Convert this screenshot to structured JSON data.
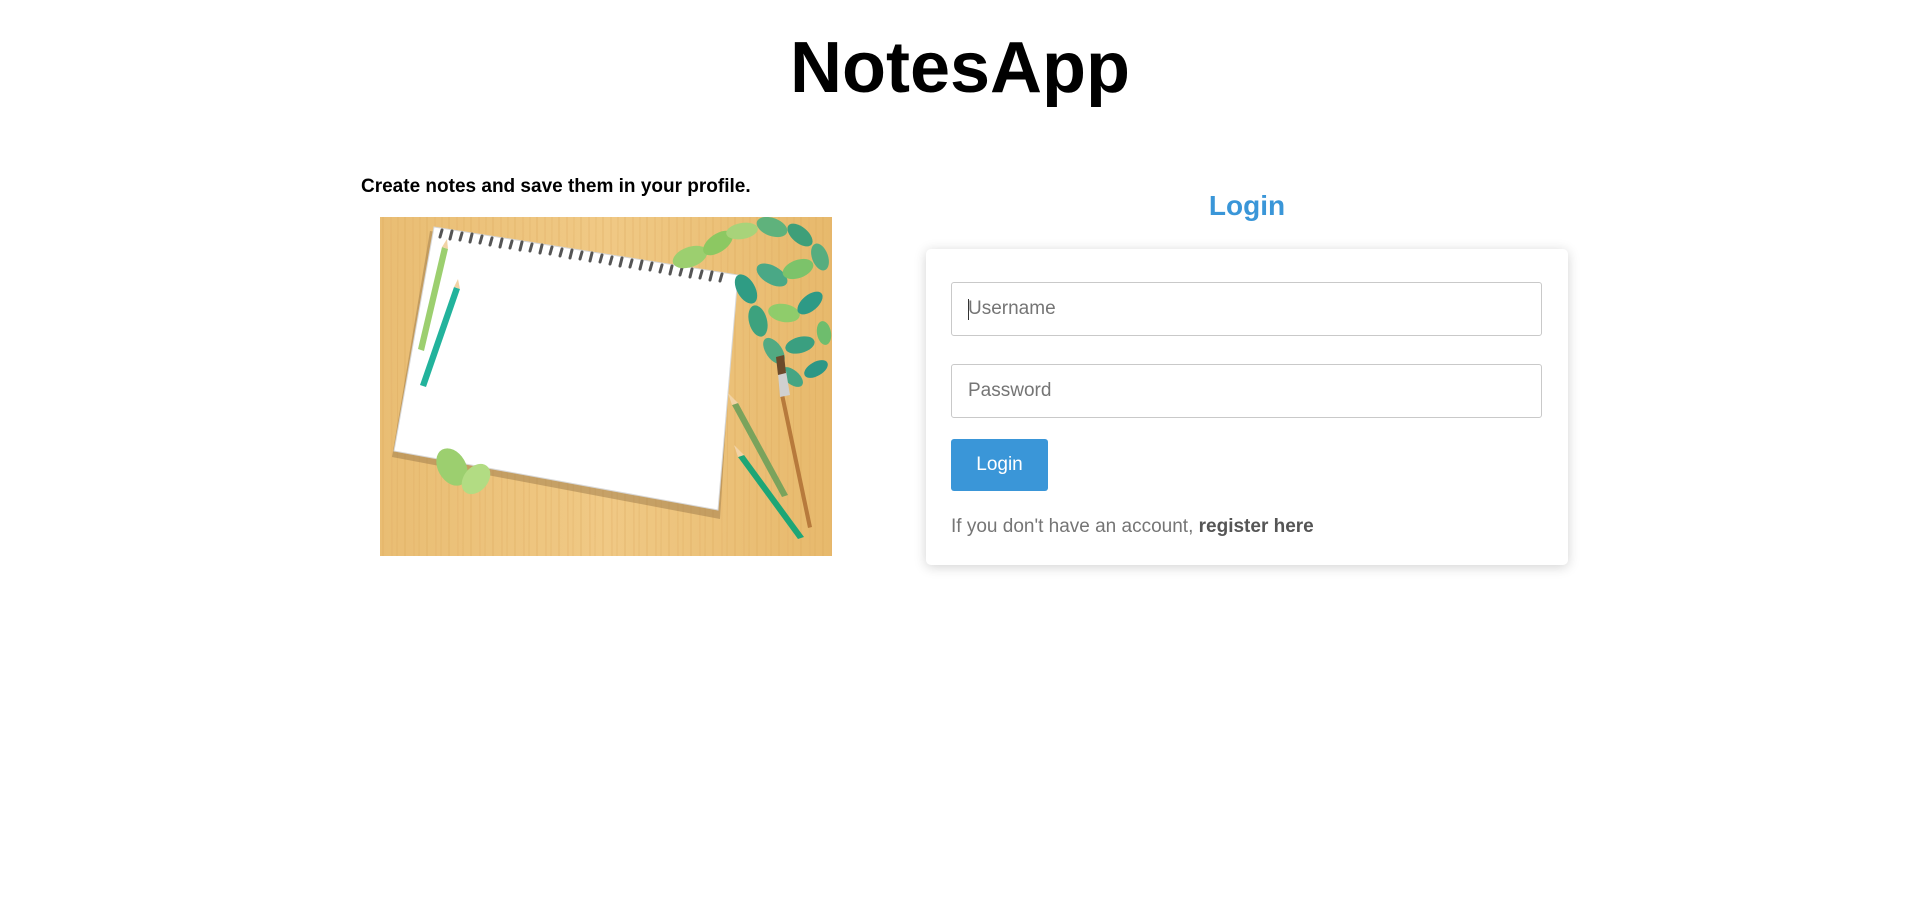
{
  "app": {
    "title": "NotesApp",
    "tagline": "Create notes and save them in your profile."
  },
  "hero": {
    "image_name": "notebook-pencils-leaves-illustration"
  },
  "login": {
    "heading": "Login",
    "username_placeholder": "Username",
    "username_value": "",
    "password_placeholder": "Password",
    "password_value": "",
    "submit_label": "Login",
    "register_prompt": "If you don't have an account, ",
    "register_link": "register here"
  },
  "colors": {
    "accent": "#3a96d8",
    "muted_text": "#757575",
    "field_border": "#c9c9c9"
  }
}
